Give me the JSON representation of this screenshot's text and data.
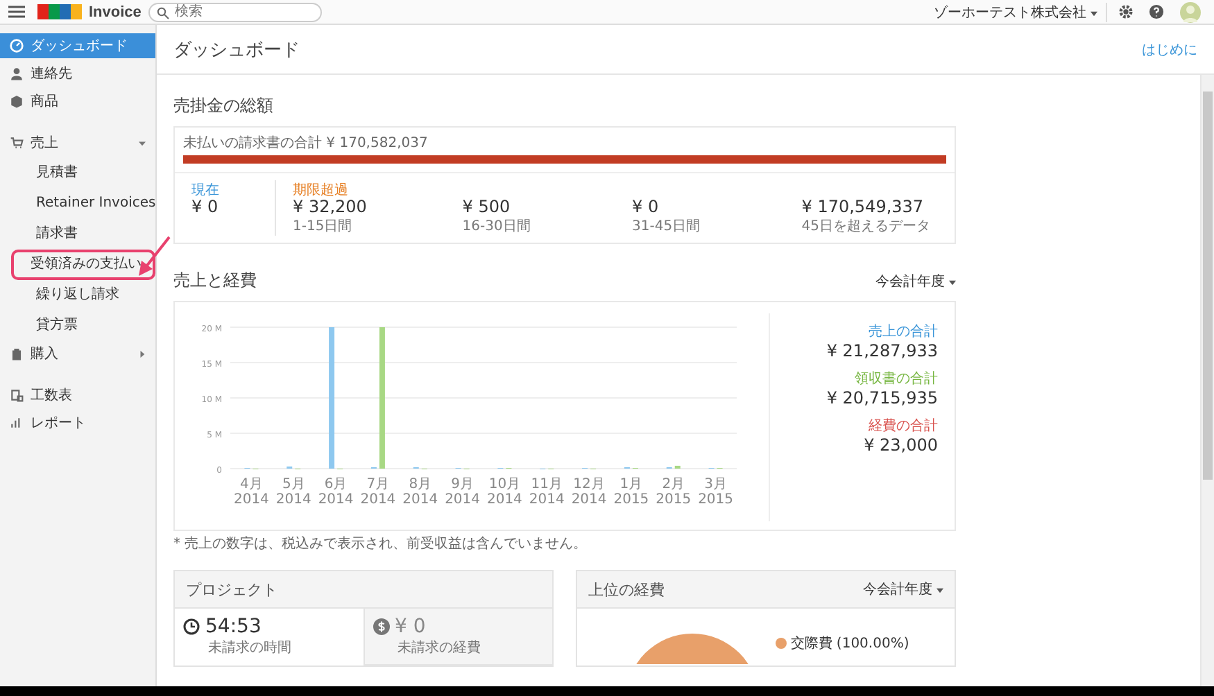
{
  "topbar": {
    "app_name": "Invoice",
    "search": {
      "placeholder": "検索"
    },
    "org": "ゾーホーテスト株式会社"
  },
  "sidebar": {
    "items": [
      {
        "label": "ダッシュボード",
        "selected": true
      },
      {
        "label": "連絡先",
        "selected": false
      },
      {
        "label": "商品",
        "selected": false
      },
      {
        "label": "売上",
        "selected": false,
        "expanded": true,
        "children": [
          {
            "label": "見積書",
            "selected": false,
            "highlighted": false
          },
          {
            "label": "Retainer Invoices",
            "selected": false,
            "highlighted": false
          },
          {
            "label": "請求書",
            "selected": false,
            "highlighted": false
          },
          {
            "label": "受領済みの支払い",
            "selected": false,
            "highlighted": true
          },
          {
            "label": "繰り返し請求",
            "selected": false,
            "highlighted": false
          },
          {
            "label": "貸方票",
            "selected": false,
            "highlighted": false
          }
        ]
      },
      {
        "label": "購入",
        "selected": false,
        "expanded": false
      },
      {
        "label": "工数表",
        "selected": false
      },
      {
        "label": "レポート",
        "selected": false
      }
    ]
  },
  "page": {
    "title": "ダッシュボード",
    "link": "はじめに"
  },
  "receivables": {
    "title": "売掛金の総額",
    "unpaid_label": "未払いの請求書の合計",
    "unpaid_total": "¥ 170,582,037",
    "level": 1.0,
    "buckets": [
      {
        "kind": "current",
        "heading": "現在",
        "amount": "¥ 0"
      },
      {
        "kind": "overdue",
        "heading": "期限超過",
        "amount": "¥ 32,200",
        "caption": "1-15日間"
      },
      {
        "kind": "overdue",
        "amount": "¥ 500",
        "caption": "16-30日間"
      },
      {
        "kind": "overdue",
        "amount": "¥ 0",
        "caption": "31-45日間"
      },
      {
        "kind": "overdue",
        "amount": "¥ 170,549,337",
        "caption": "45日を超えるデータ"
      }
    ]
  },
  "sales_expenses": {
    "title": "売上と経費",
    "period": "今会計年度",
    "chart_data": {
      "type": "bar",
      "categories": [
        "4月 2014",
        "5月 2014",
        "6月 2014",
        "7月 2014",
        "8月 2014",
        "9月 2014",
        "10月 2014",
        "11月 2014",
        "12月 2014",
        "1月 2015",
        "2月 2015",
        "3月 2015"
      ],
      "series": [
        {
          "color": "#8ec8ef",
          "values": [
            0.1,
            0.3,
            20,
            0.2,
            0.2,
            0.1,
            0.1,
            0,
            0.1,
            0.2,
            0.2,
            0.1
          ]
        },
        {
          "color": "#a8d884",
          "values": [
            0,
            0,
            0,
            20,
            0,
            0,
            0.1,
            0,
            0,
            0.1,
            0.4,
            0.1
          ]
        }
      ],
      "ylim": [
        0,
        20
      ],
      "grid": true,
      "yticks": [
        {
          "value": 0,
          "label": "0"
        },
        {
          "value": 5,
          "label": "5 M"
        },
        {
          "value": 10,
          "label": "10 M"
        },
        {
          "value": 15,
          "label": "15 M"
        },
        {
          "value": 20,
          "label": "20 M"
        }
      ]
    },
    "totals": [
      {
        "label": "売上の合計",
        "amount": "¥ 21,287,933",
        "color": "#3a95d8"
      },
      {
        "label": "領収書の合計",
        "amount": "¥ 20,715,935",
        "color": "#76b640"
      },
      {
        "label": "経費の合計",
        "amount": "¥ 23,000",
        "color": "#d9534f"
      }
    ],
    "footnote": "* 売上の数字は、税込みで表示され、前受収益は含んでいません。"
  },
  "projects": {
    "title": "プロジェクト",
    "hours": {
      "value": "54:53",
      "caption": "未請求の時間"
    },
    "expenses": {
      "value": "¥ 0",
      "caption": "未請求の経費"
    }
  },
  "top_expenses": {
    "title": "上位の経費",
    "period": "今会計年度",
    "legend": [
      {
        "label": "交際費",
        "share": "(100.00%)",
        "color": "#e8a06a"
      }
    ]
  }
}
